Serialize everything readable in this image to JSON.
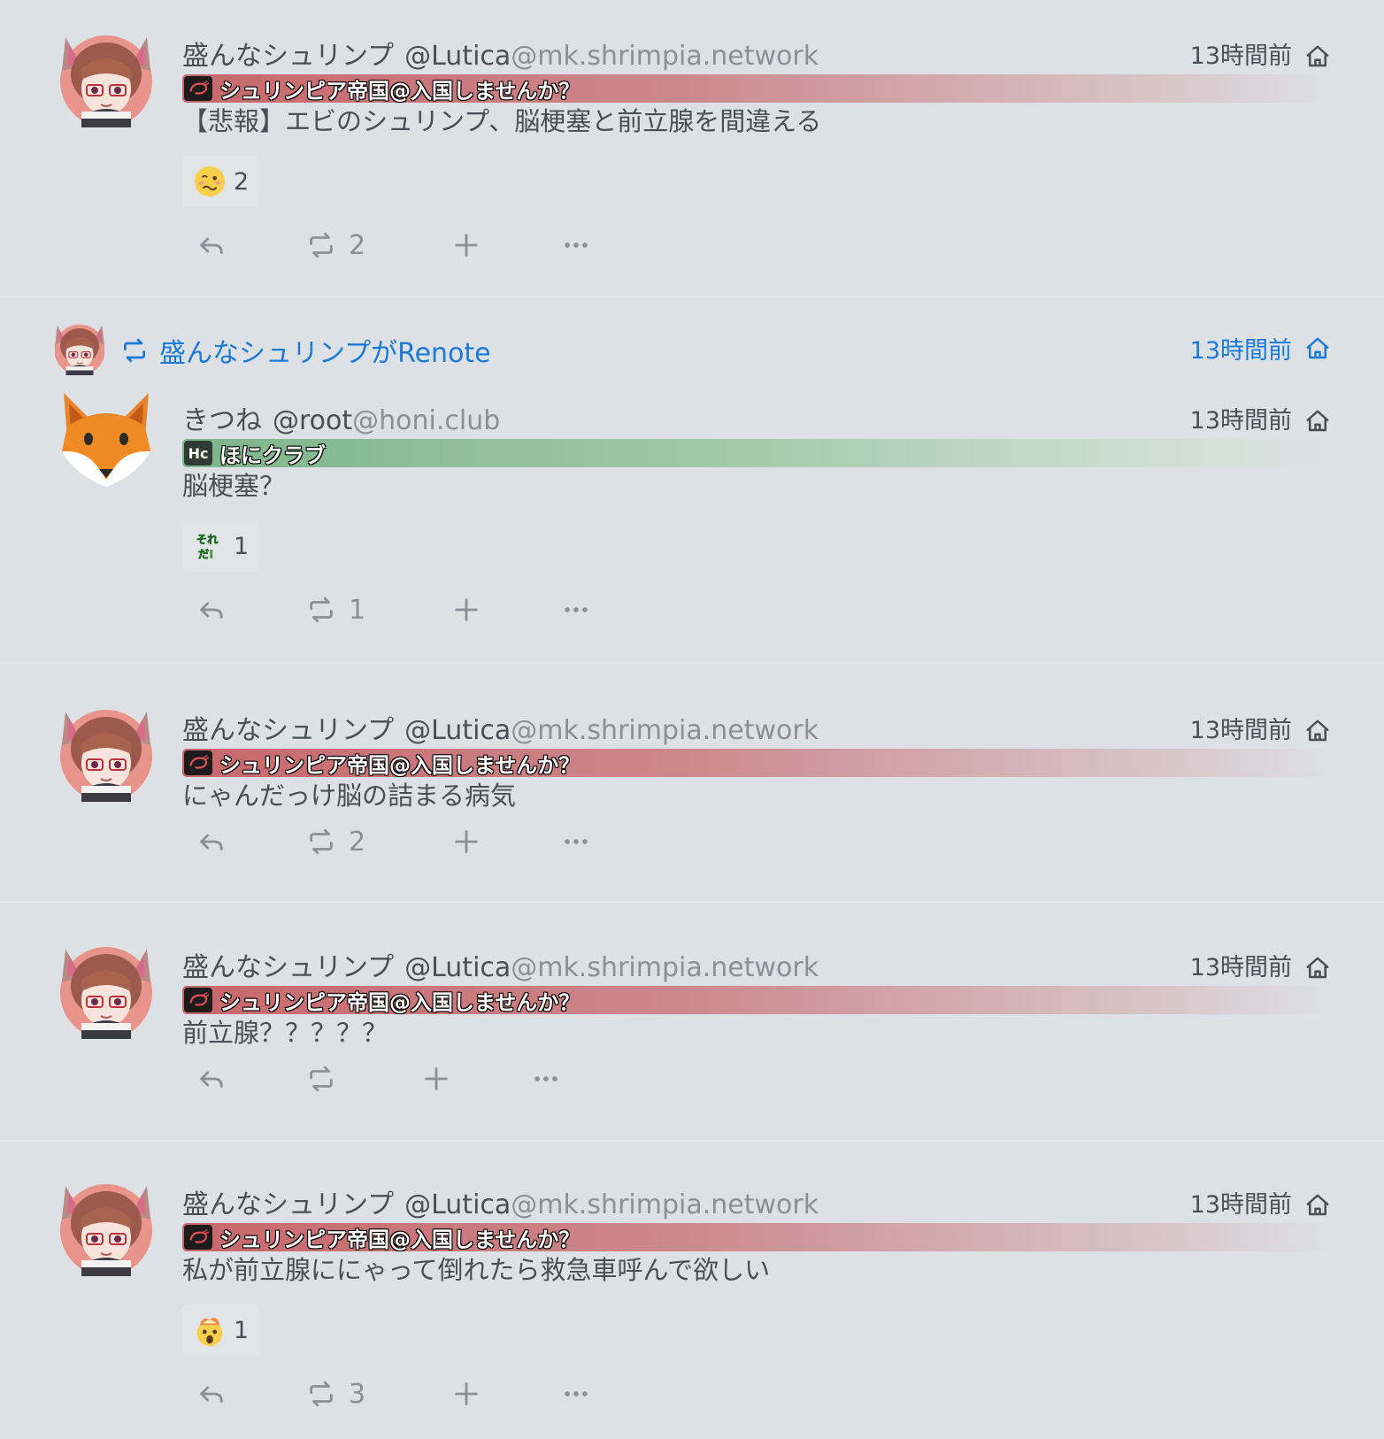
{
  "colors": {
    "background": "#dde0e5",
    "accent": "#1b7ad6",
    "text": "#4a4f57",
    "muted": "#8a8f98",
    "ticker_shrimp": "#c8676b",
    "ticker_honi": "#7fb58a"
  },
  "notes": [
    {
      "display_name": "盛んなシュリンプ",
      "username": "@Lutica",
      "host": "@mk.shrimpia.network",
      "time": "13時間前",
      "visibility_icon": "home-icon",
      "instance": "シュリンピア帝国@入国しませんか？",
      "text": "【悲報】エビのシュリンプ、脳梗塞と前立腺を間違える",
      "reaction": {
        "emoji": "woozy-face-icon",
        "count": "2"
      },
      "renote_count": "2"
    },
    {
      "renote_by": "盛んなシュリンプがRenote",
      "renote_time": "13時間前",
      "display_name": "きつね",
      "username": "@root",
      "host": "@honi.club",
      "time": "13時間前",
      "visibility_icon": "home-icon",
      "instance_icon_text": "Hc",
      "instance": "ほにクラブ",
      "text": "脳梗塞？",
      "reaction": {
        "emoji": "soreda-sticker-icon",
        "count": "1"
      },
      "renote_count": "1"
    },
    {
      "display_name": "盛んなシュリンプ",
      "username": "@Lutica",
      "host": "@mk.shrimpia.network",
      "time": "13時間前",
      "visibility_icon": "home-icon",
      "instance": "シュリンピア帝国@入国しませんか？",
      "text": "にゃんだっけ脳の詰まる病気",
      "renote_count": "2"
    },
    {
      "display_name": "盛んなシュリンプ",
      "username": "@Lutica",
      "host": "@mk.shrimpia.network",
      "time": "13時間前",
      "visibility_icon": "home-icon",
      "instance": "シュリンピア帝国@入国しませんか？",
      "text": "前立腺？？？？？",
      "renote_count": ""
    },
    {
      "display_name": "盛んなシュリンプ",
      "username": "@Lutica",
      "host": "@mk.shrimpia.network",
      "time": "13時間前",
      "visibility_icon": "home-icon",
      "instance": "シュリンピア帝国@入国しませんか？",
      "text": "私が前立腺ににゃって倒れたら救急車呼んで欲しい",
      "reaction": {
        "emoji": "exploding-head-icon",
        "count": "1"
      },
      "renote_count": "3"
    }
  ]
}
